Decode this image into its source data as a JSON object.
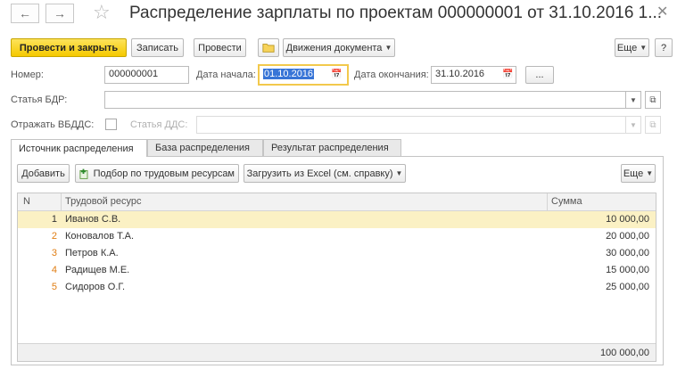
{
  "window": {
    "title": "Распределение зарплаты по проектам 000000001 от 31.10.2016 1...",
    "back_icon": "arrow-left-icon",
    "forward_icon": "arrow-right-icon",
    "favorite_icon": "star-icon",
    "close_icon": "close-icon"
  },
  "toolbar": {
    "post_and_close": "Провести и закрыть",
    "save": "Записать",
    "post": "Провести",
    "document_movements": "Движения документа",
    "more": "Еще",
    "help": "?"
  },
  "form": {
    "number_label": "Номер:",
    "number_value": "000000001",
    "start_date_label": "Дата начала:",
    "start_date_value": "01.10.2016",
    "end_date_label": "Дата окончания:",
    "end_date_value": "31.10.2016",
    "period_button": "...",
    "bdr_label": "Статья БДР:",
    "bdr_value": "",
    "reflect_vbdds_label": "Отражать ВБДДС:",
    "reflect_vbdds_checked": false,
    "dds_label": "Статья ДДС:",
    "dds_value": ""
  },
  "tabs": [
    {
      "label": "Источник распределения",
      "active": true
    },
    {
      "label": "База распределения",
      "active": false
    },
    {
      "label": "Результат распределения",
      "active": false
    }
  ],
  "table_toolbar": {
    "add": "Добавить",
    "pick": "Подбор по трудовым ресурсам",
    "load_excel": "Загрузить из Excel (см. справку)",
    "more": "Еще"
  },
  "table": {
    "columns": [
      "N",
      "Трудовой ресурс",
      "Сумма"
    ],
    "rows": [
      {
        "n": "1",
        "resource": "Иванов С.В.",
        "amount": "10 000,00",
        "selected": true
      },
      {
        "n": "2",
        "resource": "Коновалов Т.А.",
        "amount": "20 000,00",
        "selected": false
      },
      {
        "n": "3",
        "resource": "Петров К.А.",
        "amount": "30 000,00",
        "selected": false
      },
      {
        "n": "4",
        "resource": "Радищев М.Е.",
        "amount": "15 000,00",
        "selected": false
      },
      {
        "n": "5",
        "resource": "Сидоров О.Г.",
        "amount": "25 000,00",
        "selected": false
      }
    ],
    "total": "100 000,00"
  },
  "colors": {
    "primary_button": "#f5c900",
    "selected_row": "#fbf1c4",
    "row_number": "#e07d12",
    "focus_border": "#f2c94c"
  }
}
